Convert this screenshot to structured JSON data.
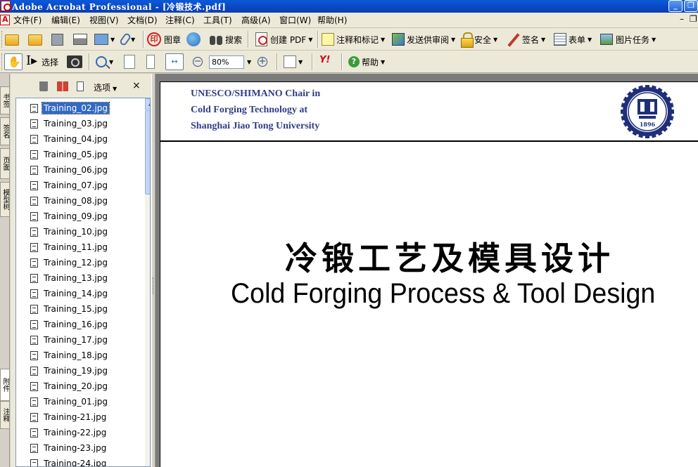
{
  "window": {
    "title": "Adobe Acrobat Professional - [冷锻技术.pdf]"
  },
  "menubar": {
    "items": [
      "文件(F)",
      "编辑(E)",
      "视图(V)",
      "文档(D)",
      "注释(C)",
      "工具(T)",
      "高级(A)",
      "窗口(W)",
      "帮助(H)"
    ]
  },
  "toolbar1": {
    "stamp_label": "图章",
    "search_label": "搜索",
    "create_pdf_label": "创建 PDF",
    "comment_label": "注释和标记",
    "review_label": "发送供审阅",
    "security_label": "安全",
    "sign_label": "签名",
    "forms_label": "表单",
    "picture_tasks_label": "图片任务"
  },
  "toolbar2": {
    "select_label": "选择",
    "zoom_value": "80%",
    "help_label": "帮助",
    "yahoo_label": "Y!"
  },
  "side_tabs": [
    "书签",
    "签名",
    "页面",
    "模型树",
    "附件",
    "注释"
  ],
  "attachments_panel": {
    "options_label": "选项",
    "close_glyph": "×",
    "files": [
      "Training_02.jpg",
      "Training_03.jpg",
      "Training_04.jpg",
      "Training_05.jpg",
      "Training_06.jpg",
      "Training_07.jpg",
      "Training_08.jpg",
      "Training_09.jpg",
      "Training_10.jpg",
      "Training_11.jpg",
      "Training_12.jpg",
      "Training_13.jpg",
      "Training_14.jpg",
      "Training_15.jpg",
      "Training_16.jpg",
      "Training_17.jpg",
      "Training_18.jpg",
      "Training_19.jpg",
      "Training_20.jpg",
      "Training_01.jpg",
      "Training-21.jpg",
      "Training-22.jpg",
      "Training-23.jpg",
      "Training-24.jpg"
    ],
    "selected_index": 0
  },
  "document": {
    "header_lines": [
      "UNESCO/SHIMANO Chair in",
      "Cold Forging Technology at",
      "Shanghai Jiao Tong University"
    ],
    "logo_year": "1896",
    "title_cn": "冷锻工艺及模具设计",
    "title_en": "Cold Forging Process & Tool Design"
  },
  "colors": {
    "titlebar": "#0b46c2",
    "header_text": "#2f3e86",
    "selection": "#316ac5",
    "doc_background": "#7b7b7b"
  }
}
